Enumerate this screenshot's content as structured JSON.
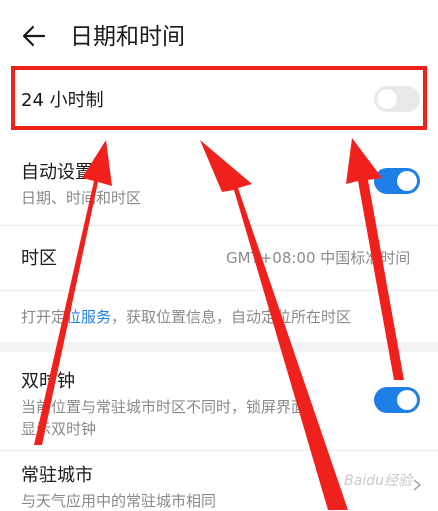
{
  "header": {
    "title": "日期和时间"
  },
  "settings": {
    "hour24": {
      "label": "24 小时制",
      "enabled": false
    },
    "auto": {
      "label": "自动设置",
      "sub": "日期、时间和时区",
      "enabled": true
    },
    "timezone": {
      "label": "时区",
      "value": "GMT+08:00 中国标准时间"
    },
    "location_note": {
      "prefix": "打开定",
      "link": "位服务",
      "suffix": "，获取位置信息，自动定位所在时区"
    },
    "dual_clock": {
      "label": "双时钟",
      "sub_line1": "当前位置与常驻城市时区不同时，锁屏界面",
      "sub_line2": "显示双时钟",
      "enabled": true
    },
    "home_city": {
      "label": "常驻城市",
      "sub": "与天气应用中的常驻城市相同"
    }
  },
  "watermark": "Baidu经验",
  "colors": {
    "accent": "#1e7fe6",
    "annotation": "#f0211d",
    "toggle_off": "#e9e9e9"
  }
}
